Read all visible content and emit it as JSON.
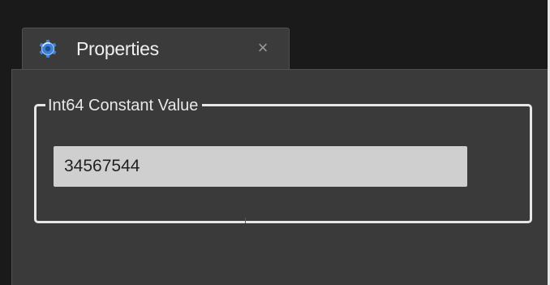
{
  "tab": {
    "title": "Properties",
    "close_symbol": "×",
    "icon": "properties-gear-icon"
  },
  "group": {
    "legend": "Int64 Constant Value"
  },
  "input": {
    "value": "34567544"
  },
  "colors": {
    "app_background": "#1a1a1a",
    "panel_background": "#3a3a3a",
    "tab_background": "#3b3b3b",
    "groupbox_border": "#e6e6e6",
    "input_background": "#cfcfcf",
    "icon_blue": "#3f7fd6"
  }
}
